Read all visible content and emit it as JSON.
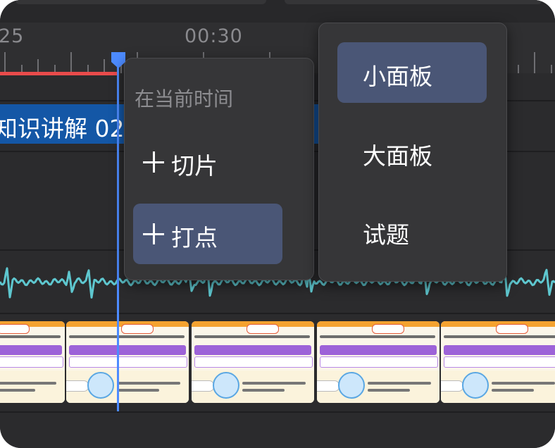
{
  "ruler": {
    "labels": [
      "25",
      "00:30"
    ]
  },
  "timeline": {
    "chapter_label": "知识讲解  02"
  },
  "add_menu": {
    "heading": "在当前时间",
    "items": [
      {
        "label": "切片",
        "selected": false
      },
      {
        "label": "打点",
        "selected": true
      }
    ]
  },
  "panel_menu": {
    "items": [
      {
        "label": "小面板",
        "selected": true
      },
      {
        "label": "大面板",
        "selected": false
      },
      {
        "label": "试题",
        "selected": false
      }
    ]
  },
  "colors": {
    "background": "#2b2b2d",
    "chapter_clip": "#1457a6",
    "progress": "#e84b4b",
    "playhead": "#4d8bff",
    "waveform": "#5ec7cf",
    "menu_bg": "#363638",
    "selected_item": "#4a5676"
  },
  "icons": {
    "add": "plus-icon",
    "playhead": "playhead-marker-icon"
  }
}
